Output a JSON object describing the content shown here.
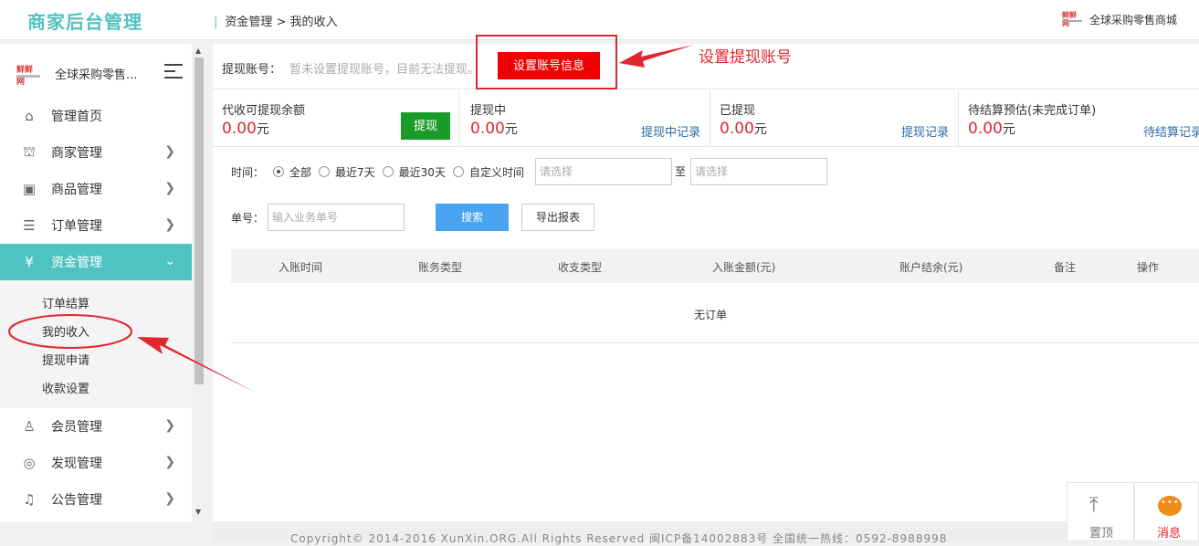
{
  "header": {
    "brand": "商家后台管理",
    "breadcrumb_sep": "|",
    "breadcrumb": "资金管理 > 我的收入",
    "shop_name": "全球采购零售商城",
    "logo_text": "鲜鲜网"
  },
  "sidebar": {
    "shop_name": "全球采购零售...",
    "logo_text": "鲜鲜网",
    "items": [
      {
        "label": "管理首页",
        "icon": "home-icon",
        "glyph": "⌂",
        "has_arrow": false
      },
      {
        "label": "商家管理",
        "icon": "store-icon",
        "glyph": "⛫",
        "has_arrow": true
      },
      {
        "label": "商品管理",
        "icon": "product-icon",
        "glyph": "▣",
        "has_arrow": true
      },
      {
        "label": "订单管理",
        "icon": "order-icon",
        "glyph": "☰",
        "has_arrow": true
      },
      {
        "label": "资金管理",
        "icon": "yuan-icon",
        "glyph": "¥",
        "has_arrow": true,
        "active": true
      },
      {
        "label": "会员管理",
        "icon": "member-icon",
        "glyph": "♙",
        "has_arrow": true
      },
      {
        "label": "发现管理",
        "icon": "discover-icon",
        "glyph": "◎",
        "has_arrow": true
      },
      {
        "label": "公告管理",
        "icon": "notice-icon",
        "glyph": "♫",
        "has_arrow": true
      }
    ],
    "sub_items": [
      "订单结算",
      "我的收入",
      "提现申请",
      "收款设置"
    ]
  },
  "account": {
    "label": "提现账号：",
    "hint": "暂未设置提现账号，目前无法提现。",
    "button": "设置账号信息"
  },
  "annotation": {
    "text": "设置提现账号"
  },
  "stats": [
    {
      "title": "代收可提现余额",
      "amount": "0.00",
      "unit": "元",
      "button": "提现"
    },
    {
      "title": "提现中",
      "amount": "0.00",
      "unit": "元",
      "link": "提现中记录"
    },
    {
      "title": "已提现",
      "amount": "0.00",
      "unit": "元",
      "link": "提现记录"
    },
    {
      "title": "待结算预估(未完成订单)",
      "amount": "0.00",
      "unit": "元",
      "link": "待结算记录"
    }
  ],
  "filters": {
    "time_label": "时间：",
    "options": [
      "全部",
      "最近7天",
      "最近30天",
      "自定义时间"
    ],
    "selected": "全部",
    "start_placeholder": "请选择",
    "to_label": "至",
    "end_placeholder": "请选择",
    "order_label": "单号：",
    "order_placeholder": "输入业务单号",
    "search_button": "搜索",
    "export_button": "导出报表"
  },
  "table": {
    "columns": [
      "入账时间",
      "账务类型",
      "收支类型",
      "入账金额(元)",
      "账户结余(元)",
      "备注",
      "操作"
    ],
    "empty_text": "无订单"
  },
  "footer": {
    "text": "Copyright© 2014-2016 XunXin.ORG.All Rights Reserved 闽ICP备14002883号 全国统一热线：0592-8988998"
  },
  "float": {
    "top_label": "置顶",
    "message_label": "消息"
  },
  "colors": {
    "accent": "#4fc3c2",
    "danger": "#f00000",
    "annotation": "#e0262e",
    "green": "#1a9b27",
    "blue": "#4aa3f0",
    "link": "#2a6aa6",
    "orange": "#f08c19"
  }
}
